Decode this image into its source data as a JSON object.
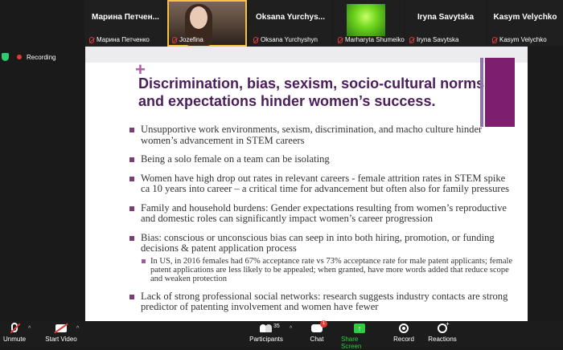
{
  "participants": [
    {
      "display_name": "Марина  Петчен...",
      "label": "Марина Петченко"
    },
    {
      "display_name": "",
      "label": "Jozefina"
    },
    {
      "display_name": "Oksana  Yurchys...",
      "label": "Oksana Yurchyshyn"
    },
    {
      "display_name": "",
      "label": "Marharyta Shumeiko"
    },
    {
      "display_name": "Iryna  Savytska",
      "label": "Iryna Savytska"
    },
    {
      "display_name": "Kasym  Velychko",
      "label": "Kasym Velychko"
    }
  ],
  "recording": {
    "label": "Recording"
  },
  "slide": {
    "plus": "+",
    "title": "Discrimination, bias, sexism, socio-cultural norms and expectations hinder women’s success.",
    "bullets": [
      "Unsupportive work environments, sexism,  discrimination, and macho culture hinder women’s advancement in STEM careers",
      "Being a solo female on a team can be isolating",
      "Women have high drop out rates in relevant careers  - female attrition rates in STEM spike ca 10 years into career – a critical time for advancement but often also for family pressures",
      "Family and household burdens: Gender expectations resulting from women’s reproductive and domestic roles can significantly impact women’s career progression",
      "Bias: conscious or unconscious bias can seep in into both hiring, promotion, or funding decisions & patent application process",
      "Lack of strong professional social networks: research suggests industry contacts are strong predictor of patenting involvement and women have fewer"
    ],
    "sub_bullet": "In US, in 2016 females had 67% acceptance rate vs 73% acceptance rate for male patent applicants; female patent applications are less likely to be appealed; when granted, have more words added that reduce scope and weaken protection"
  },
  "toolbar": {
    "unmute": "Unmute",
    "start_video": "Start Video",
    "participants": "Participants",
    "participants_count": "35",
    "chat": "Chat",
    "chat_badge": "1",
    "share_screen": "Share Screen",
    "record": "Record",
    "reactions": "Reactions"
  },
  "colors": {
    "accent_green": "#2ecc40",
    "muted_red": "#e03a3a",
    "slide_title": "#4b1d5c",
    "slide_accent": "#7e1e6e"
  }
}
